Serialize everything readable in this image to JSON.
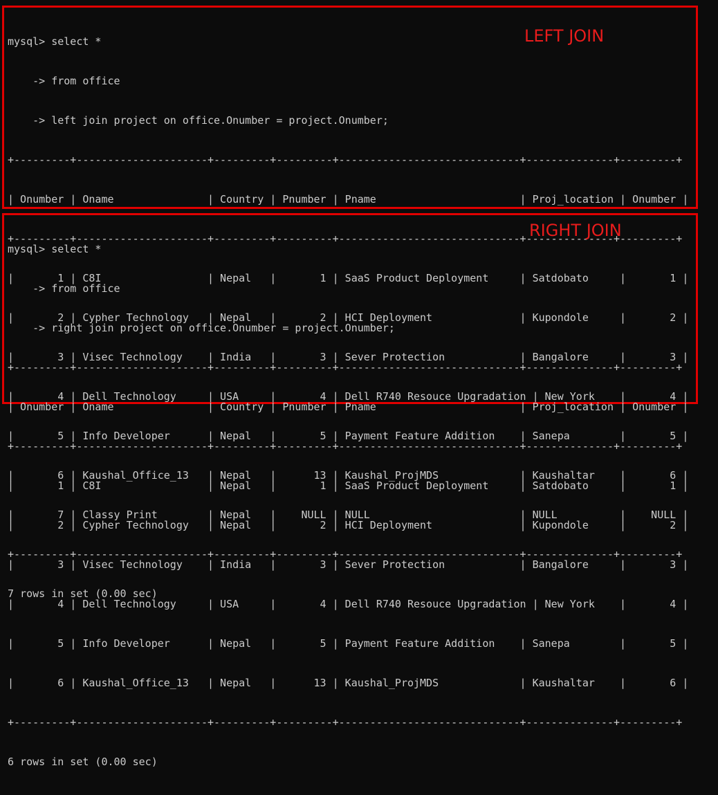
{
  "left_block": {
    "label": "LEFT JOIN",
    "prompt_lines": [
      "mysql> select *",
      "    -> from office",
      "    -> left join project on office.Onumber = project.Onumber;"
    ],
    "border": "+---------+---------------------+---------+---------+-----------------------------+--------------+---------+",
    "header": "| Onumber | Oname               | Country | Pnumber | Pname                       | Proj_location | Onumber |",
    "rows": [
      "|       1 | C8I                 | Nepal   |       1 | SaaS Product Deployment     | Satdobato     |       1 |",
      "|       2 | Cypher Technology   | Nepal   |       2 | HCI Deployment              | Kupondole     |       2 |",
      "|       3 | Visec Technology    | India   |       3 | Sever Protection            | Bangalore     |       3 |",
      "|       4 | Dell Technology     | USA     |       4 | Dell R740 Resouce Upgradation | New York    |       4 |",
      "|       5 | Info Developer      | Nepal   |       5 | Payment Feature Addition    | Sanepa        |       5 |",
      "|       6 | Kaushal_Office_13   | Nepal   |      13 | Kaushal_ProjMDS             | Kaushaltar    |       6 |",
      "|       7 | Classy Print        | Nepal   |    NULL | NULL                        | NULL          |    NULL |"
    ],
    "footer": "7 rows in set (0.00 sec)"
  },
  "right_block": {
    "label": "RIGHT JOIN",
    "prompt_lines": [
      "mysql> select *",
      "    -> from office",
      "    -> right join project on office.Onumber = project.Onumber;"
    ],
    "border": "+---------+---------------------+---------+---------+-----------------------------+--------------+---------+",
    "header": "| Onumber | Oname               | Country | Pnumber | Pname                       | Proj_location | Onumber |",
    "rows": [
      "|       1 | C8I                 | Nepal   |       1 | SaaS Product Deployment     | Satdobato     |       1 |",
      "|       2 | Cypher Technology   | Nepal   |       2 | HCI Deployment              | Kupondole     |       2 |",
      "|       3 | Visec Technology    | India   |       3 | Sever Protection            | Bangalore     |       3 |",
      "|       4 | Dell Technology     | USA     |       4 | Dell R740 Resouce Upgradation | New York    |       4 |",
      "|       5 | Info Developer      | Nepal   |       5 | Payment Feature Addition    | Sanepa        |       5 |",
      "|       6 | Kaushal_Office_13   | Nepal   |      13 | Kaushal_ProjMDS             | Kaushaltar    |       6 |"
    ],
    "footer": "6 rows in set (0.00 sec)"
  },
  "colors": {
    "background": "#0c0c0c",
    "text": "#cccccc",
    "annotation": "#e81c1c"
  }
}
